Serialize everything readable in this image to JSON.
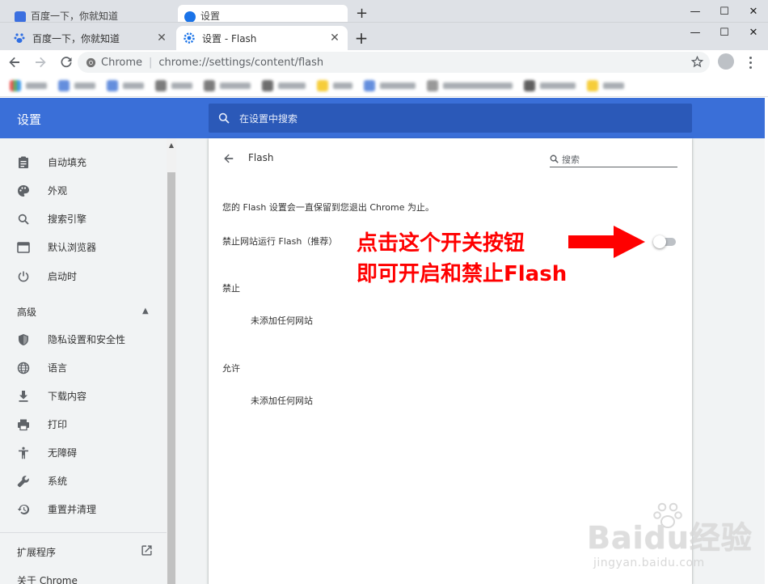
{
  "background_window": {
    "tabs": [
      {
        "title": "百度一下，你就知道"
      },
      {
        "title": "设置"
      }
    ]
  },
  "tabs": [
    {
      "title": "百度一下，你就知道",
      "active": false
    },
    {
      "title": "设置 - Flash",
      "active": true
    }
  ],
  "omnibox": {
    "chrome_label": "Chrome",
    "url": "chrome://settings/content/flash"
  },
  "settings_header": {
    "title": "设置",
    "search_placeholder": "在设置中搜索"
  },
  "sidebar": {
    "items_top": [
      {
        "label": "自动填充",
        "icon": "clipboard-icon"
      },
      {
        "label": "外观",
        "icon": "palette-icon"
      },
      {
        "label": "搜索引擎",
        "icon": "search-icon"
      },
      {
        "label": "默认浏览器",
        "icon": "browser-icon"
      },
      {
        "label": "启动时",
        "icon": "power-icon"
      }
    ],
    "advanced_label": "高级",
    "items_advanced": [
      {
        "label": "隐私设置和安全性",
        "icon": "shield-icon"
      },
      {
        "label": "语言",
        "icon": "globe-icon"
      },
      {
        "label": "下载内容",
        "icon": "download-icon"
      },
      {
        "label": "打印",
        "icon": "printer-icon"
      },
      {
        "label": "无障碍",
        "icon": "accessibility-icon"
      },
      {
        "label": "系统",
        "icon": "wrench-icon"
      },
      {
        "label": "重置并清理",
        "icon": "restore-icon"
      }
    ],
    "extensions_label": "扩展程序",
    "about_label": "关于 Chrome"
  },
  "card": {
    "title": "Flash",
    "search_placeholder": "搜索",
    "description": "您的 Flash 设置会一直保留到您退出 Chrome 为止。",
    "toggle_label": "禁止网站运行 Flash（推荐）",
    "toggle_on": false,
    "block_section": "禁止",
    "block_empty": "未添加任何网站",
    "allow_section": "允许",
    "allow_empty": "未添加任何网站"
  },
  "annotation": {
    "line1": "点击这个开关按钮",
    "line2": "即可开启和禁止Flash",
    "color": "#ff0000"
  },
  "watermark": {
    "logo": "Baidu经验",
    "url": "jingyan.baidu.com"
  },
  "colors": {
    "header_blue": "#3a6fd8",
    "search_blue": "#2b59b8",
    "page_bg": "#f1f3f4"
  }
}
